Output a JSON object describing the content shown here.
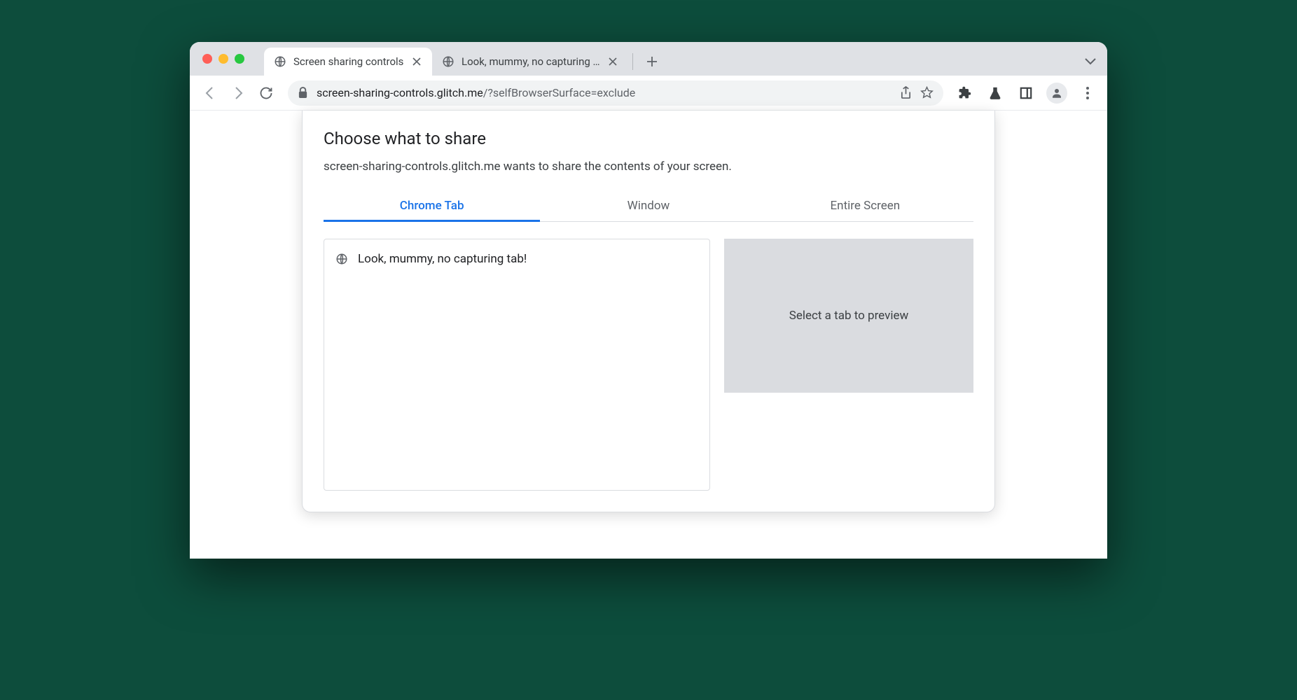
{
  "browser": {
    "tabs": [
      {
        "title": "Screen sharing controls",
        "active": true
      },
      {
        "title": "Look, mummy, no capturing tab",
        "active": false
      }
    ],
    "url_host": "screen-sharing-controls.glitch.me",
    "url_path": "/?selfBrowserSurface=exclude"
  },
  "dialog": {
    "title": "Choose what to share",
    "subtitle": "screen-sharing-controls.glitch.me wants to share the contents of your screen.",
    "tabs": {
      "chrome_tab": "Chrome Tab",
      "window": "Window",
      "entire_screen": "Entire Screen"
    },
    "tab_list": [
      {
        "title": "Look, mummy, no capturing tab!"
      }
    ],
    "preview_placeholder": "Select a tab to preview"
  }
}
